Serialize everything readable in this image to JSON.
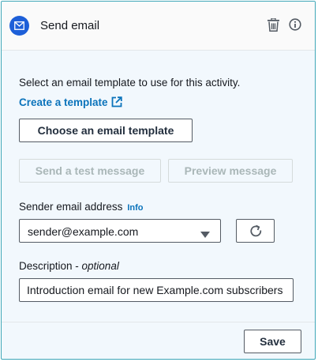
{
  "header": {
    "title": "Send email",
    "icon": "mail-icon",
    "actions": [
      "trash-icon",
      "info-icon"
    ]
  },
  "template": {
    "intro": "Select an email template to use for this activity.",
    "create_link": "Create a template",
    "choose_button": "Choose an email template"
  },
  "actions": {
    "test_button": "Send a test message",
    "preview_button": "Preview message"
  },
  "sender": {
    "label": "Sender email address",
    "info": "Info",
    "value": "sender@example.com"
  },
  "description": {
    "label": "Description - ",
    "optional": "optional",
    "value": "Introduction email for new Example.com subscribers"
  },
  "footer": {
    "save_button": "Save"
  },
  "colors": {
    "accent": "#0b73bb",
    "icon_bg": "#1d5fd8",
    "panel_border": "#3fa7b8",
    "panel_bg": "#f2f8fd"
  }
}
